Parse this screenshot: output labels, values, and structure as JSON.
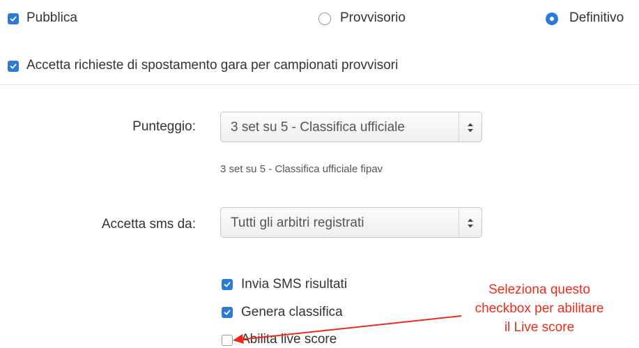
{
  "publish": {
    "label": "Pubblica",
    "checked": true
  },
  "status_options": [
    {
      "label": "Provvisorio",
      "selected": false
    },
    {
      "label": "Definitivo",
      "selected": true
    }
  ],
  "accept_requests": {
    "label": "Accetta richieste di spostamento gara per campionati provvisori",
    "checked": true
  },
  "score": {
    "label": "Punteggio:",
    "value": "3 set su 5 - Classifica ufficiale",
    "hint": "3 set su 5 - Classifica ufficiale fipav"
  },
  "sms": {
    "label": "Accetta sms da:",
    "value": "Tutti gli arbitri registrati"
  },
  "options": [
    {
      "label": "Invia SMS risultati",
      "checked": true
    },
    {
      "label": "Genera classifica",
      "checked": true
    },
    {
      "label": "Abilita live score",
      "checked": false
    }
  ],
  "annotation": {
    "line1": "Seleziona questo",
    "line2": "checkbox per abilitare",
    "line3": "il Live score",
    "color": "#ee2a1b"
  },
  "colors": {
    "accent": "#2b7bd6",
    "annotation": "#ee2a1b"
  }
}
